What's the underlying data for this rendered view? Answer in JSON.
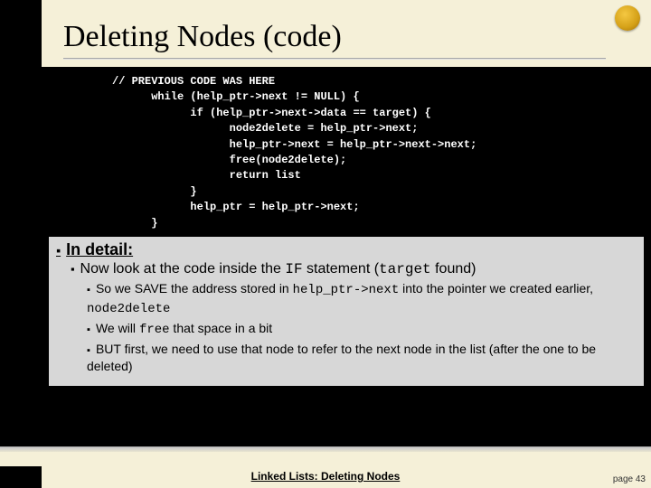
{
  "title": "Deleting Nodes (code)",
  "code": {
    "l1": "// PREVIOUS CODE WAS HERE",
    "l2": "      while (help_ptr->next != NULL) {",
    "l3": "            if (help_ptr->next->data == target) {",
    "l4": "                  node2delete = help_ptr->next;",
    "l5": "                  help_ptr->next = help_ptr->next->next;",
    "l6": "                  free(node2delete);",
    "l7": "                  return list",
    "l8": "            }",
    "l9": "            help_ptr = help_ptr->next;",
    "l10": "      }"
  },
  "detail_heading": "In detail:",
  "d2_a": "Now look at the code inside the ",
  "d2_if": "IF",
  "d2_b": " statement (",
  "d2_target": "target",
  "d2_c": " found)",
  "d3_1a": "So we SAVE the address stored in ",
  "d3_1m": "help_ptr->next",
  "d3_1b": " into the pointer we created earlier, ",
  "d3_1m2": "node2delete",
  "d3_2a": "We will ",
  "d3_2m": "free",
  "d3_2b": " that space in a bit",
  "d3_3": "BUT first, we need to use that node to refer to the next node in the list (after the one to be deleted)",
  "footer": "Linked Lists:  Deleting Nodes",
  "page": "page 43"
}
